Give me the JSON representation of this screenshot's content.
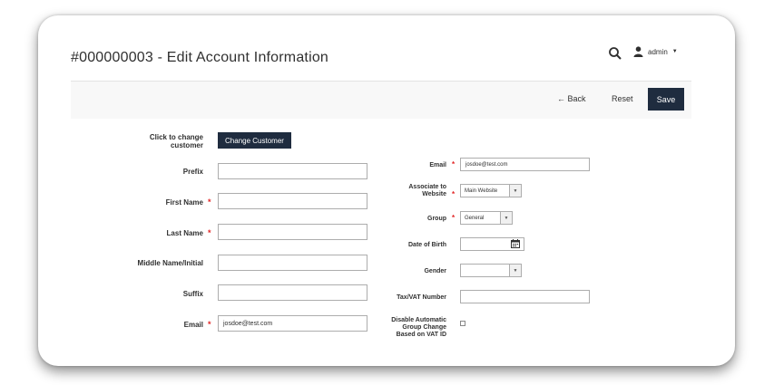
{
  "header": {
    "title": "#000000003 - Edit Account Information",
    "user": "admin"
  },
  "actions": {
    "back": "← Back",
    "reset": "Reset",
    "save": "Save"
  },
  "left_form": {
    "change_customer_label": "Click to change customer",
    "change_customer_button": "Change Customer",
    "prefix_label": "Prefix",
    "prefix_value": "",
    "first_name_label": "First Name",
    "first_name_value": "",
    "last_name_label": "Last Name",
    "last_name_value": "",
    "middle_name_label": "Middle Name/Initial",
    "middle_name_value": "",
    "suffix_label": "Suffix",
    "suffix_value": "",
    "email_label": "Email",
    "email_value": "josdoe@test.com",
    "required_mark": "*"
  },
  "right_form": {
    "email_label": "Email",
    "email_value": "josdoe@test.com",
    "website_label": "Associate to Website",
    "website_value": "Main Website",
    "group_label": "Group",
    "group_value": "General",
    "dob_label": "Date of Birth",
    "dob_value": "",
    "gender_label": "Gender",
    "gender_value": "",
    "taxvat_label": "Tax/VAT Number",
    "taxvat_value": "",
    "disable_group_label": "Disable Automatic Group Change Based on VAT ID"
  },
  "icons": {
    "search": "search-icon",
    "user": "user-icon",
    "calendar": "calendar-icon",
    "dropdown": "chevron-down-icon"
  },
  "colors": {
    "primary_button": "#1f2c3f",
    "required": "#e22626",
    "toolbar": "#f8f8f8"
  }
}
